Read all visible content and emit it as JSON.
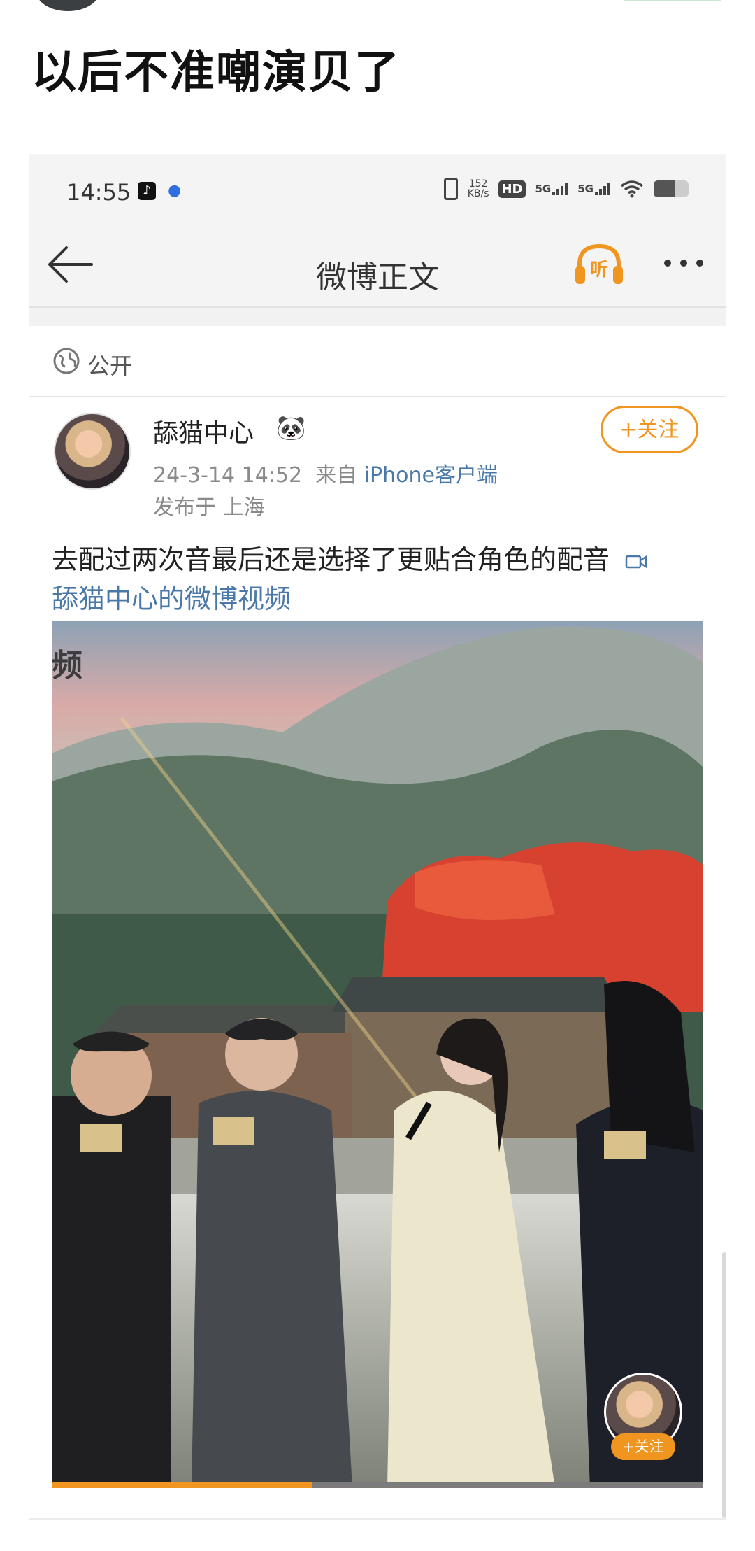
{
  "outer_post": {
    "title": "以后不准嘲演贝了"
  },
  "status_bar": {
    "time": "14:55",
    "net_speed": "152",
    "net_speed_unit": "KB/s",
    "hd_label": "HD",
    "sim1": "5G",
    "sim2": "5G",
    "battery_level": 0.62
  },
  "nav": {
    "title": "微博正文",
    "listen_label": "听"
  },
  "visibility": {
    "label": "公开"
  },
  "author": {
    "name": "舔猫中心",
    "emoji": "🐼",
    "follow_label": "+关注"
  },
  "post": {
    "date": "24-3-14 14:52",
    "from_prefix": "来自",
    "client": "iPhone客户端",
    "location": "发布于 上海",
    "text": "去配过两次音最后还是选择了更贴合角色的配音",
    "video_link": "舔猫中心的微博视频"
  },
  "video": {
    "corner_text": "频",
    "mini_follow_label": "+关注",
    "progress": 0.4
  },
  "colors": {
    "accent_orange": "#f0951f",
    "link_blue": "#4a78a8"
  }
}
